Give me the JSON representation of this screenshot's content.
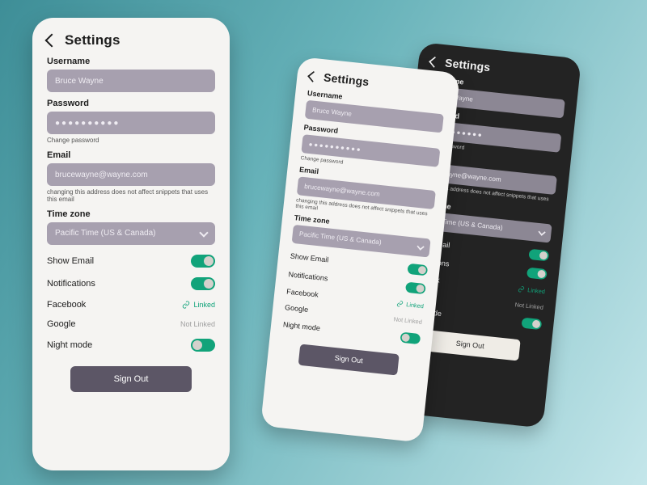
{
  "title": "Settings",
  "labels": {
    "username": "Username",
    "password": "Password",
    "email": "Email",
    "timezone": "Time zone"
  },
  "values": {
    "username": "Bruce Wayne",
    "password_mask": "●●●●●●●●●●",
    "email": "brucewayne@wayne.com",
    "timezone": "Pacific Time (US & Canada)"
  },
  "hints": {
    "change_password": "Change password",
    "email_note": "changing this address does not affect snippets that uses this email"
  },
  "rows": {
    "show_email": "Show Email",
    "notifications": "Notifications",
    "facebook": "Facebook",
    "google": "Google",
    "night_mode": "Night mode"
  },
  "link_status": {
    "linked": "Linked",
    "not_linked": "Not Linked"
  },
  "actions": {
    "sign_out": "Sign Out"
  },
  "toggles": {
    "show_email": true,
    "notifications": true,
    "night_mode_light": "mid",
    "night_mode_dark": true
  },
  "colors": {
    "accent": "#11a37a",
    "field": "#a7a0af",
    "button": "#5c5666"
  }
}
